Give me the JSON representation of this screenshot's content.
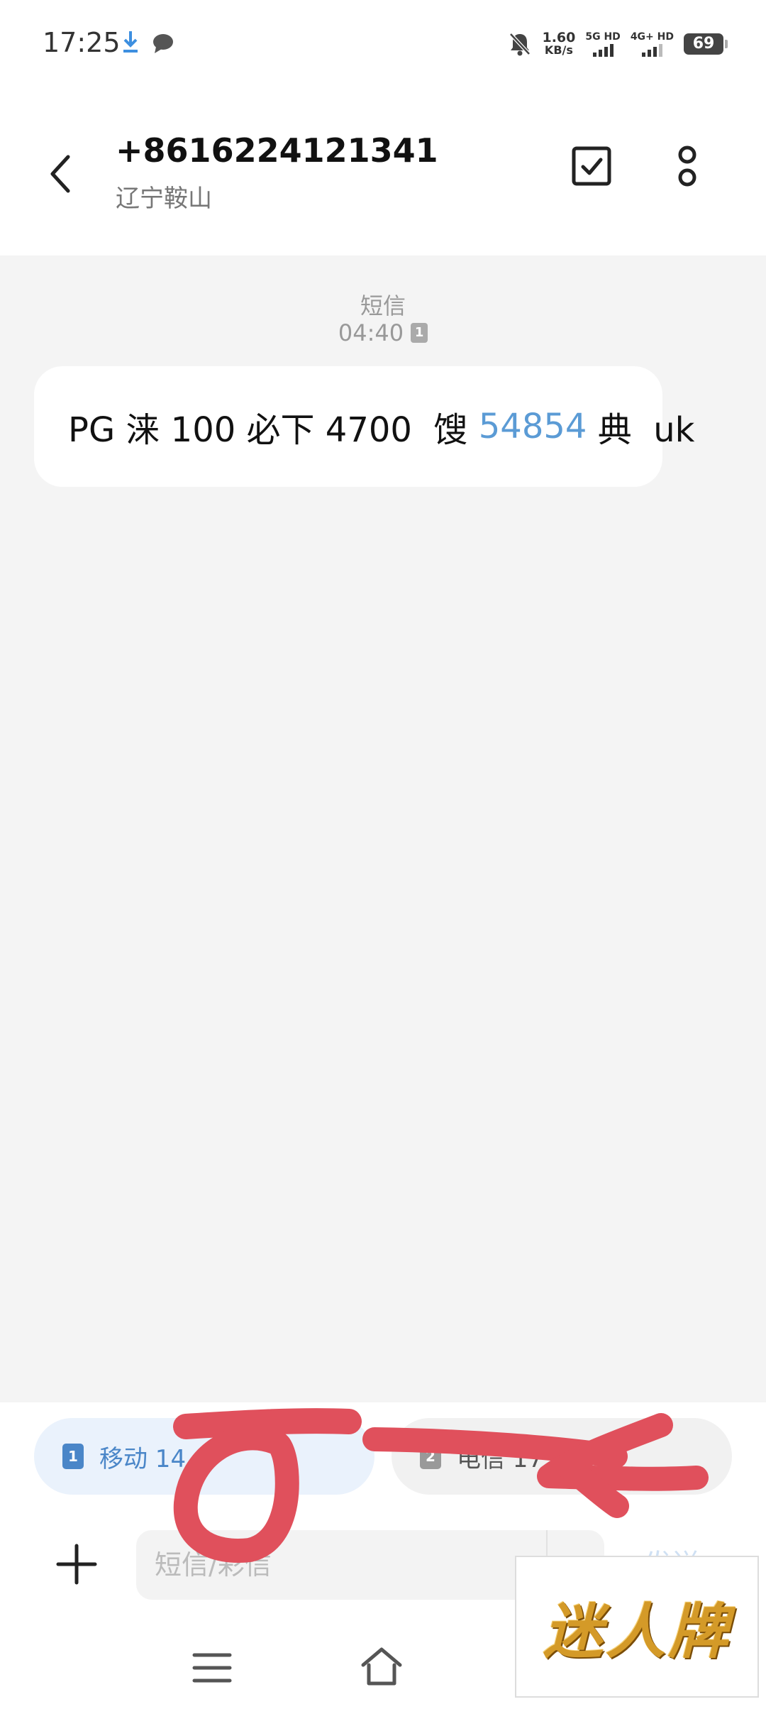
{
  "status_bar": {
    "time": "17:25",
    "network_speed_value": "1.60",
    "network_speed_unit": "KB/s",
    "signal_1_label": "5G HD",
    "signal_2_label": "4G+ HD",
    "battery": "69"
  },
  "header": {
    "title": "+8616224121341",
    "subtitle": "辽宁鞍山"
  },
  "conversation": {
    "message_type": "短信",
    "timestamp": "04:40",
    "sim_indicator": "1",
    "message": {
      "text_before_link": "PG 涞 100 必下 4700  馊 ",
      "link": "54854",
      "text_after_link": " 典  uk"
    }
  },
  "bottom_bar": {
    "sim_buttons": [
      {
        "sim": "1",
        "label": "移动 14"
      },
      {
        "sim": "2",
        "label": "电信 17"
      }
    ],
    "input_placeholder": "短信/彩信",
    "send_label": "发送"
  },
  "watermark": {
    "text": "迷人牌"
  },
  "colors": {
    "accent": "#4a86c8",
    "link": "#5b9bd5",
    "scribble": "#e0505c",
    "background": "#f4f4f4"
  }
}
